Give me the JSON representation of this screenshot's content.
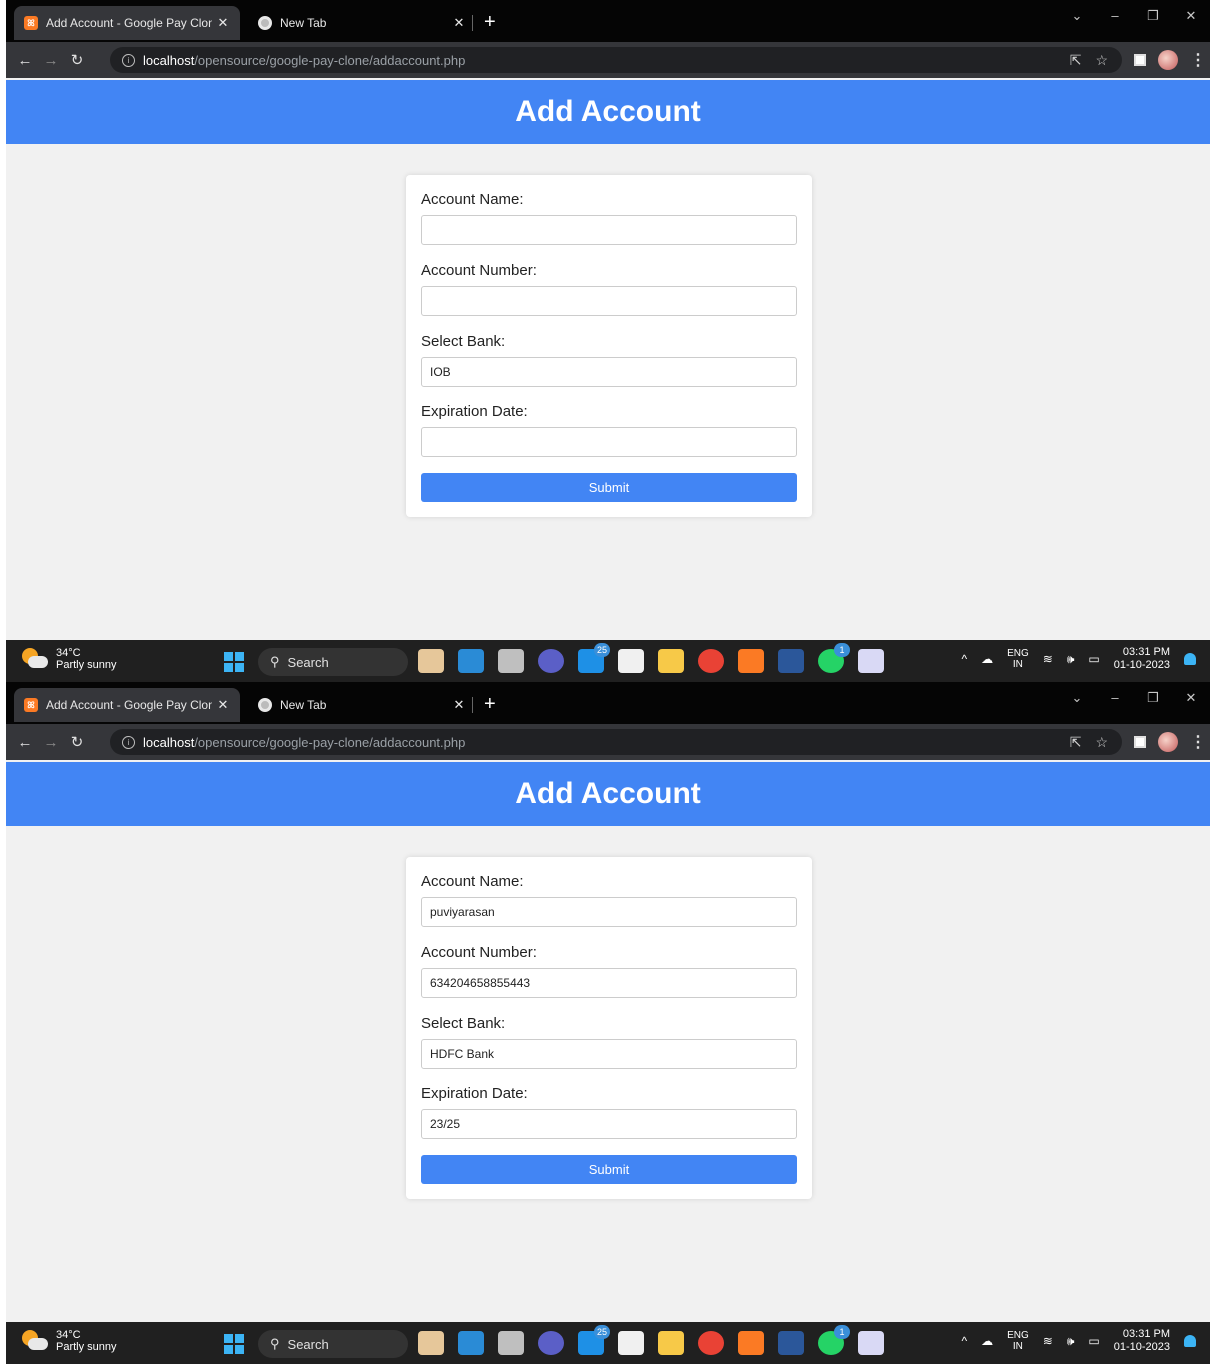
{
  "browser": {
    "active_tab_title": "Add Account - Google Pay Clon",
    "inactive_tab_title": "New Tab",
    "url_host": "localhost",
    "url_path": "/opensource/google-pay-clone/addaccount.php"
  },
  "page": {
    "title": "Add Account",
    "labels": {
      "account_name": "Account Name:",
      "account_number": "Account Number:",
      "select_bank": "Select Bank:",
      "expiration_date": "Expiration Date:"
    },
    "submit_label": "Submit"
  },
  "screens": [
    {
      "values": {
        "account_name": "",
        "account_number": "",
        "select_bank": "IOB",
        "expiration_date": ""
      }
    },
    {
      "values": {
        "account_name": "puviyarasan",
        "account_number": "634204658855443",
        "select_bank": "HDFC Bank",
        "expiration_date": "23/25"
      }
    }
  ],
  "taskbar": {
    "temperature": "34°C",
    "weather": "Partly sunny",
    "search_label": "Search",
    "mail_badge": "25",
    "whatsapp_badge": "1",
    "lang_top": "ENG",
    "lang_bottom": "IN",
    "time": "03:31 PM",
    "date": "01-10-2023"
  },
  "colors": {
    "accent": "#4285f4",
    "page_bg": "#f1f1f1",
    "taskbar_bg": "#202020"
  }
}
